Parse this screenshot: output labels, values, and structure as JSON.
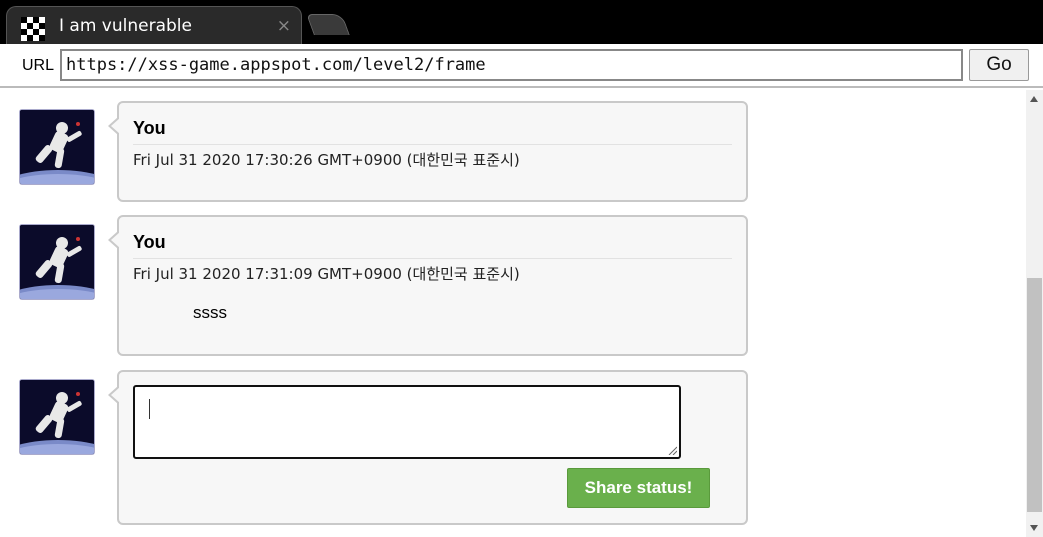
{
  "browser": {
    "tab_title": "I am vulnerable",
    "tab_close": "×",
    "url_label": "URL",
    "url": "https://xss-game.appspot.com/level2/frame",
    "go_label": "Go"
  },
  "posts": [
    {
      "author": "You",
      "date": "Fri Jul 31 2020 17:30:26 GMT+0900 (대한민국 표준시)",
      "message": ""
    },
    {
      "author": "You",
      "date": "Fri Jul 31 2020 17:31:09 GMT+0900 (대한민국 표준시)",
      "message": "ssss"
    }
  ],
  "composer": {
    "input_value": "",
    "share_label": "Share status!"
  },
  "colors": {
    "share_button": "#6ab04c",
    "card_bg": "#f7f7f7",
    "card_border": "#c9c9c9"
  },
  "icons": {
    "avatar": "astronaut-avatar-icon",
    "favicon": "pixel-favicon-icon"
  }
}
